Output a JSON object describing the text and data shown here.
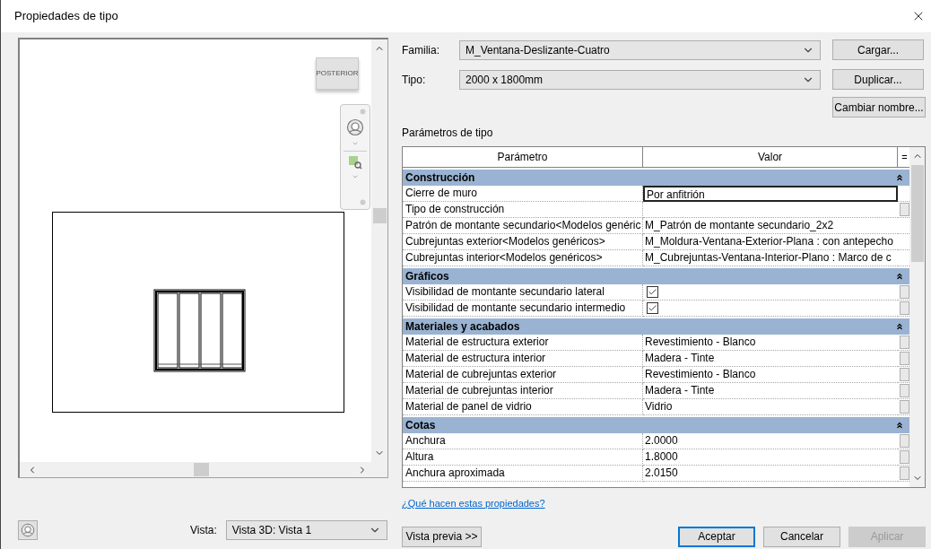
{
  "window": {
    "title": "Propiedades de tipo"
  },
  "preview": {
    "view_cube_label": "POSTERIOR",
    "view_label": "Vista:",
    "view_value": "Vista 3D: Vista 1"
  },
  "family": {
    "label": "Familia:",
    "value": "M_Ventana-Deslizante-Cuatro"
  },
  "type": {
    "label": "Tipo:",
    "value": "2000 x 1800mm"
  },
  "side_buttons": [
    "Cargar...",
    "Duplicar...",
    "Cambiar nombre..."
  ],
  "parameters_label": "Parámetros de tipo",
  "table": {
    "columns": [
      "Parámetro",
      "Valor",
      "="
    ],
    "groups": [
      {
        "title": "Construcción",
        "expanded": true,
        "rows": [
          {
            "name": "Cierre de muro",
            "kind": "text",
            "value": "Por anfitrión",
            "selected": true,
            "has_button": false
          },
          {
            "name": "Tipo de construcción",
            "kind": "text",
            "value": "",
            "selected": false,
            "has_button": true
          },
          {
            "name": "Patrón de montante secundario<Modelos genéric",
            "kind": "text",
            "value": "M_Patrón de montante secundario_2x2",
            "selected": false,
            "has_button": false
          },
          {
            "name": "Cubrejuntas exterior<Modelos genéricos>",
            "kind": "text",
            "value": "M_Moldura-Ventana-Exterior-Plana : con antepecho",
            "selected": false,
            "has_button": false
          },
          {
            "name": "Cubrejuntas interior<Modelos genéricos>",
            "kind": "text",
            "value": "M_Cubrejuntas-Ventana-Interior-Plano : Marco de c",
            "selected": false,
            "has_button": false
          }
        ]
      },
      {
        "title": "Gráficos",
        "expanded": true,
        "rows": [
          {
            "name": "Visibilidad de montante secundario lateral",
            "kind": "check",
            "checked": true,
            "selected": false,
            "has_button": true
          },
          {
            "name": "Visibilidad de montante secundario intermedio",
            "kind": "check",
            "checked": true,
            "selected": false,
            "has_button": true
          }
        ]
      },
      {
        "title": "Materiales y acabados",
        "expanded": true,
        "rows": [
          {
            "name": "Material de estructura exterior",
            "kind": "text",
            "value": "Revestimiento - Blanco",
            "selected": false,
            "has_button": true
          },
          {
            "name": "Material de estructura interior",
            "kind": "text",
            "value": "Madera - Tinte",
            "selected": false,
            "has_button": true
          },
          {
            "name": "Material de cubrejuntas exterior",
            "kind": "text",
            "value": "Revestimiento - Blanco",
            "selected": false,
            "has_button": true
          },
          {
            "name": "Material de cubrejuntas interior",
            "kind": "text",
            "value": "Madera - Tinte",
            "selected": false,
            "has_button": true
          },
          {
            "name": "Material de panel de vidrio",
            "kind": "text",
            "value": "Vidrio",
            "selected": false,
            "has_button": true
          }
        ]
      },
      {
        "title": "Cotas",
        "expanded": true,
        "rows": [
          {
            "name": "Anchura",
            "kind": "text",
            "value": "2.0000",
            "selected": false,
            "has_button": true
          },
          {
            "name": "Altura",
            "kind": "text",
            "value": "1.8000",
            "selected": false,
            "has_button": true
          },
          {
            "name": "Anchura aproximada",
            "kind": "text",
            "value": "2.0150",
            "selected": false,
            "has_button": true
          }
        ]
      }
    ]
  },
  "help_link": "¿Qué hacen estas propiedades?",
  "preview_button": "Vista previa >>",
  "buttons": [
    {
      "label": "Aceptar",
      "default": true,
      "disabled": false
    },
    {
      "label": "Cancelar",
      "default": false,
      "disabled": false
    },
    {
      "label": "Aplicar",
      "default": false,
      "disabled": true
    }
  ]
}
